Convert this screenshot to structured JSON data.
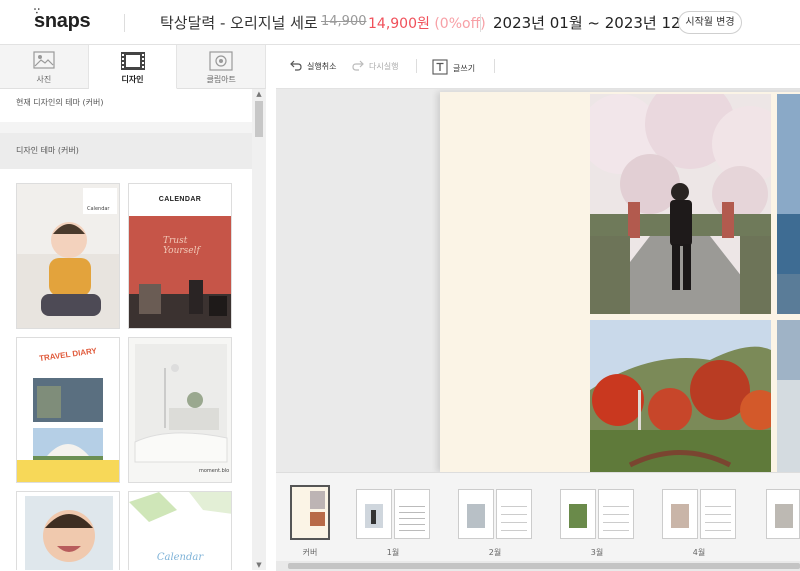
{
  "header": {
    "logo": "snaps",
    "product": "탁상달력 - 오리지널 세로",
    "price_original": "14,900",
    "price_sale": "14,900원",
    "discount": "(0%off)",
    "period": "2023년 01월 ~ 2023년 12월",
    "start_month_button": "시작월 변경"
  },
  "left_panel": {
    "tabs": [
      {
        "label": "사진",
        "icon": "photo-icon"
      },
      {
        "label": "디자인",
        "icon": "design-icon"
      },
      {
        "label": "클립아트",
        "icon": "clipart-icon"
      }
    ],
    "active_tab": "디자인",
    "current_theme_title": "현재 디자인의 테마 (커버)",
    "theme_title": "디자인 테마 (커버)",
    "thumb_texts": {
      "baby_cover_small": "Calendar",
      "calendar_title": "CALENDAR",
      "neon": "Trust Yourself",
      "travel": "TRAVEL DIARY",
      "bedroom": "moment.blo",
      "calendar_script": "Calendar"
    }
  },
  "toolbar": {
    "undo": "실행취소",
    "redo": "다시실행",
    "text": "글쓰기"
  },
  "filmstrip": {
    "items": [
      {
        "label": "커버"
      },
      {
        "label": "1월"
      },
      {
        "label": "2월"
      },
      {
        "label": "3월"
      },
      {
        "label": "4월"
      }
    ]
  },
  "colors": {
    "sale_price": "#f0505a",
    "discount": "#f7a0a6",
    "page_background": "#fbf4e6"
  }
}
